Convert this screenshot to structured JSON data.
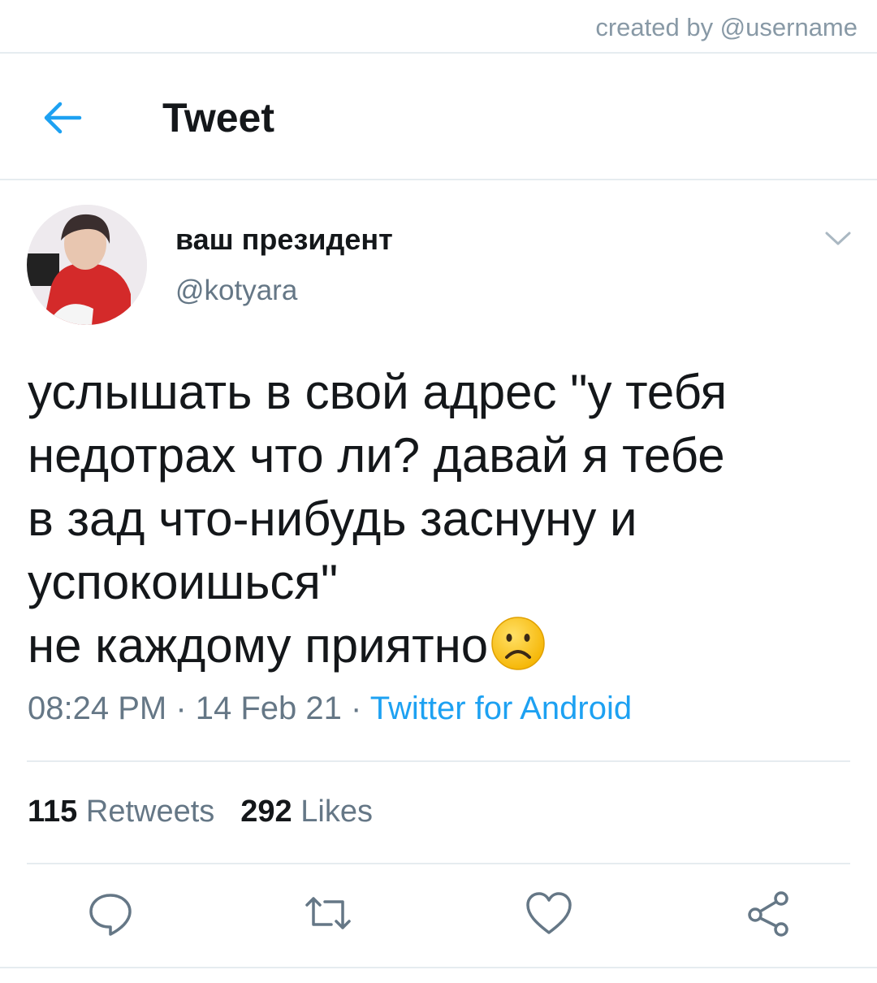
{
  "credit": "created by @username",
  "header": {
    "title": "Tweet",
    "back_icon": "arrow-left-icon"
  },
  "tweet": {
    "author_name": "ваш президент",
    "author_handle": "@kotyara",
    "text_lines": [
      "услышать в свой адрес \"у тебя",
      "недотрах что ли? давай я тебе",
      "в зад что-нибудь заснуну и",
      "успокоишься\"",
      "не каждому приятно"
    ],
    "emoji": "frowning-face",
    "time": "08:24 PM",
    "date": "14 Feb 21",
    "separator": " · ",
    "source": "Twitter for Android",
    "retweets_count": "115",
    "retweets_label": "Retweets",
    "likes_count": "292",
    "likes_label": "Likes"
  },
  "actions": [
    "reply-icon",
    "retweet-icon",
    "like-icon",
    "share-icon"
  ],
  "colors": {
    "accent": "#1da1f2",
    "secondary_text": "#657786",
    "border": "#e6ecf0"
  }
}
